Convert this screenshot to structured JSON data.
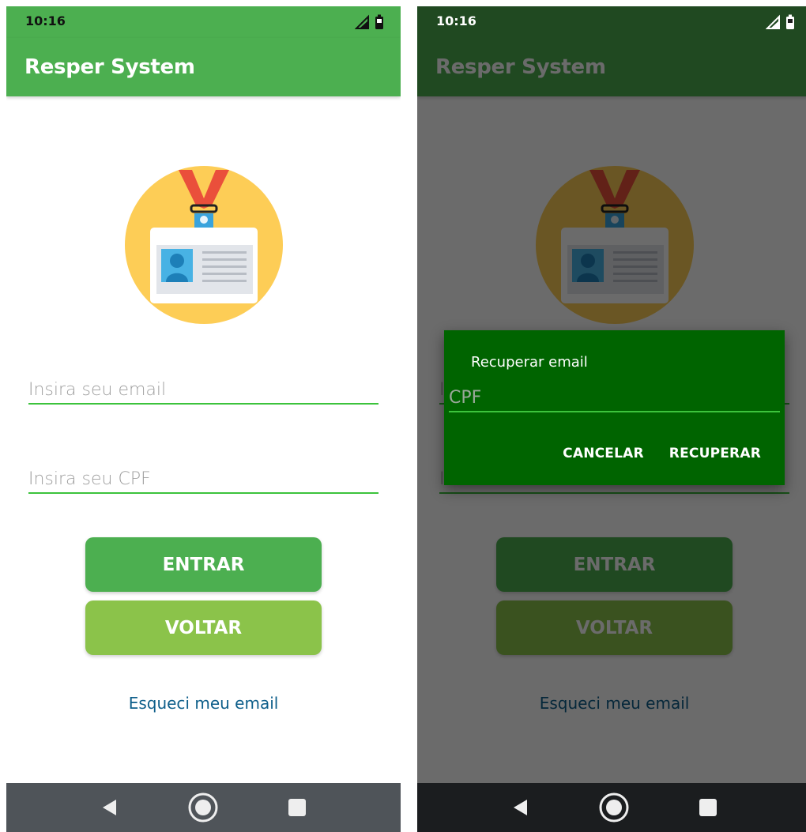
{
  "status_bar": {
    "time": "10:16"
  },
  "app_bar": {
    "title": "Resper System"
  },
  "login_form": {
    "email_placeholder": "Insira seu email",
    "cpf_placeholder": "Insira seu CPF",
    "entrar_label": "ENTRAR",
    "voltar_label": "VOLTAR",
    "forgot_link": "Esqueci meu email"
  },
  "recover_dialog": {
    "title": "Recuperar email",
    "cpf_placeholder": "CPF",
    "cancel_label": "CANCELAR",
    "confirm_label": "RECUPERAR"
  },
  "icons": {
    "signal": "signal-icon",
    "battery": "battery-icon",
    "badge": "id-badge-icon",
    "nav_back": "back-triangle-icon",
    "nav_home": "home-circle-icon",
    "nav_recent": "recents-square-icon"
  },
  "colors": {
    "primary": "#4caf50",
    "secondary": "#8bc34a",
    "dialog_bg": "#006400",
    "link": "#0d5e8a",
    "underline": "#3cc33c"
  }
}
